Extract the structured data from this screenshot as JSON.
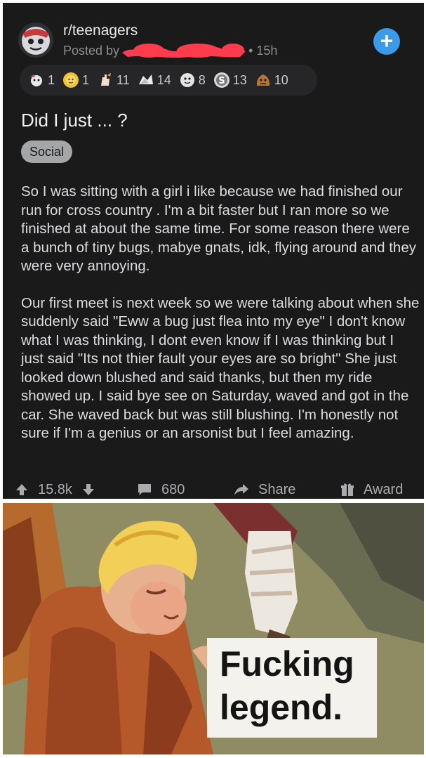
{
  "header": {
    "subreddit": "r/teenagers",
    "posted_by_prefix": "Posted by",
    "time_ago": "• 15h",
    "avatar_icon": "subreddit-avatar-icon",
    "plus_icon": "plus-icon",
    "accent_color": "#3b9be8"
  },
  "awards": [
    {
      "icon": "award-hugz-icon",
      "count": "1"
    },
    {
      "icon": "award-sun-icon",
      "count": "1"
    },
    {
      "icon": "award-hand-icon",
      "count": "11"
    },
    {
      "icon": "award-wholesome-icon",
      "count": "14"
    },
    {
      "icon": "award-face-icon",
      "count": "8"
    },
    {
      "icon": "award-silver-icon",
      "count": "13"
    },
    {
      "icon": "award-gold-icon",
      "count": "10"
    }
  ],
  "post": {
    "title": "Did I just ... ?",
    "flair": "Social",
    "paragraphs": [
      "So I was sitting with a girl i like because we had finished our run for cross country . I'm a bit faster but I ran more so we finished at about the same time. For some reason there were a bunch of tiny bugs, mabye gnats, idk, flying around and they were very annoying.",
      "Our first meet is next week so we were talking about when she suddenly said \"Eww a bug just flea into my eye\" I don't know what I was thinking, I dont even know if I was thinking but I just said \"Its not thier fault your eyes are so bright\" She just looked down blushed and said thanks, but then my ride showed up. I said bye see on Saturday,  waved and got in the car. She waved back but was still blushing. I'm honestly not sure if I'm a genius or an arsonist but I feel amazing."
    ]
  },
  "actions": {
    "upvotes": "15.8k",
    "comments": "680",
    "share": "Share",
    "award": "Award"
  },
  "meme": {
    "caption": "Fucking\nlegend."
  }
}
